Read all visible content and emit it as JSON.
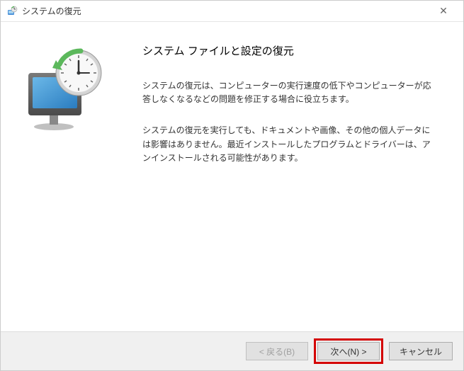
{
  "titlebar": {
    "title": "システムの復元"
  },
  "content": {
    "heading": "システム ファイルと設定の復元",
    "paragraph1": "システムの復元は、コンピューターの実行速度の低下やコンピューターが応答しなくなるなどの問題を修正する場合に役立ちます。",
    "paragraph2": "システムの復元を実行しても、ドキュメントや画像、その他の個人データには影響はありません。最近インストールしたプログラムとドライバーは、アンインストールされる可能性があります。"
  },
  "buttons": {
    "back": "< 戻る(B)",
    "next": "次へ(N) >",
    "cancel": "キャンセル"
  }
}
